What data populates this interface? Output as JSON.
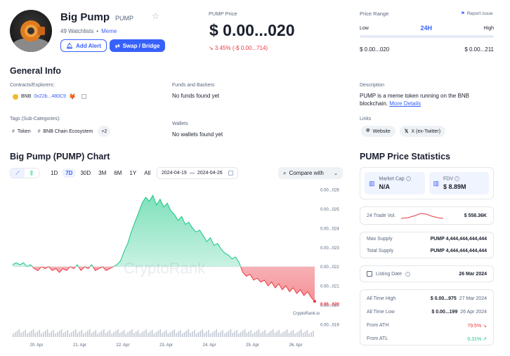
{
  "token": {
    "name": "Big Pump",
    "symbol": "PUMP",
    "watchlists": "49 Watchlists",
    "dot": "•",
    "category": "Meme",
    "add_alert": "Add Alert",
    "swap_bridge": "Swap / Bridge"
  },
  "price": {
    "label": "PUMP Price",
    "value": "$ 0.00...020",
    "change": "↘ 3.45% (-$ 0.00...714)"
  },
  "range": {
    "label": "Price Range",
    "report": "Report issue",
    "low": "Low",
    "period": "24H",
    "high": "High",
    "low_value": "$ 0.00...020",
    "high_value": "$ 0.00...211"
  },
  "general": {
    "title": "General Info",
    "contracts_label": "Contracts/Explorers:",
    "chain": "BNB",
    "address": "0x22b...480C9",
    "tags_label": "Tags (Sub-Categories):",
    "tags": [
      "Token",
      "BNB Chain Ecosystem"
    ],
    "tags_more": "+2",
    "funds_label": "Funds and Backers",
    "funds_value": "No funds found yet",
    "wallets_label": "Wallets",
    "wallets_value": "No wallets found yet",
    "description_label": "Description",
    "description_text": "PUMP is a meme token running on the BNB blockchain.",
    "more_details": "More Details",
    "links_label": "Links",
    "website": "Website",
    "twitter": "X (ex-Twitter)"
  },
  "chart": {
    "title": "Big Pump (PUMP) Chart",
    "timeframes": [
      "1D",
      "7D",
      "30D",
      "3M",
      "6M",
      "1Y",
      "All"
    ],
    "active_timeframe": "7D",
    "date_from": "2024-04-19",
    "date_sep": "—",
    "date_to": "2024-04-26",
    "compare": "Compare with",
    "watermark": "CryptoRank",
    "source": "CryptoRank.io"
  },
  "chart_data": {
    "type": "area",
    "baseline": 2.2e-09,
    "ylim": [
      1.9e-09,
      2.6e-09
    ],
    "y_ticks": [
      {
        "v": 2.6e-09,
        "label": "0.00...026"
      },
      {
        "v": 2.5e-09,
        "label": "0.00...025"
      },
      {
        "v": 2.4e-09,
        "label": "0.00...024"
      },
      {
        "v": 2.3e-09,
        "label": "0.00...023"
      },
      {
        "v": 2.2e-09,
        "label": "0.00...022"
      },
      {
        "v": 2.1e-09,
        "label": "0.00...021"
      },
      {
        "v": 2e-09,
        "label": "0.00...020"
      },
      {
        "v": 1.9e-09,
        "label": "0.00...019"
      }
    ],
    "x_labels": [
      "20. Apr",
      "21. Apr",
      "22. Apr",
      "23. Apr",
      "24. Apr",
      "25. Apr",
      "26. Apr"
    ],
    "current_label": "0.00...020",
    "values": [
      2.21,
      2.22,
      2.21,
      2.22,
      2.2,
      2.21,
      2.19,
      2.18,
      2.2,
      2.19,
      2.2,
      2.18,
      2.19,
      2.17,
      2.19,
      2.18,
      2.2,
      2.19,
      2.21,
      2.18,
      2.2,
      2.19,
      2.21,
      2.18,
      2.19,
      2.2,
      2.18,
      2.19,
      2.2,
      2.21,
      2.23,
      2.28,
      2.32,
      2.38,
      2.43,
      2.48,
      2.53,
      2.56,
      2.54,
      2.57,
      2.52,
      2.55,
      2.51,
      2.53,
      2.49,
      2.47,
      2.44,
      2.46,
      2.42,
      2.43,
      2.4,
      2.38,
      2.39,
      2.36,
      2.33,
      2.35,
      2.31,
      2.32,
      2.29,
      2.27,
      2.26,
      2.24,
      2.25,
      2.22,
      2.17,
      2.15,
      2.16,
      2.13,
      2.14,
      2.12,
      2.13,
      2.1,
      2.12,
      2.09,
      2.11,
      2.08,
      2.1,
      2.07,
      2.09,
      2.06,
      2.08,
      2.05,
      2.07,
      2.04,
      2.02
    ]
  },
  "stats": {
    "title": "PUMP Price Statistics",
    "market_cap_label": "Market Cap",
    "market_cap_value": "N/A",
    "fdv_label": "FDV",
    "fdv_value": "$ 8.89M",
    "volume_label": "24 Trade Vol.",
    "volume_value": "$ 558.36K",
    "max_supply_label": "Max Supply",
    "max_supply_value": "PUMP 4,444,444,444,444",
    "total_supply_label": "Total Supply",
    "total_supply_value": "PUMP 4,444,444,444,444",
    "listing_label": "Listing Date",
    "listing_value": "26 Mar 2024",
    "ath_label": "All Time High",
    "ath_value": "$ 0.00...975",
    "ath_date": "27 Mar 2024",
    "atl_label": "All Time Low",
    "atl_value": "$ 0.00...199",
    "atl_date": "26 Apr 2024",
    "from_ath_label": "From ATH",
    "from_ath_value": "79.5% ↘",
    "from_atl_label": "From ATL",
    "from_atl_value": "0.31% ↗"
  },
  "colors": {
    "accent": "#3861fb",
    "up": "#16c784",
    "down": "#ea3943"
  }
}
